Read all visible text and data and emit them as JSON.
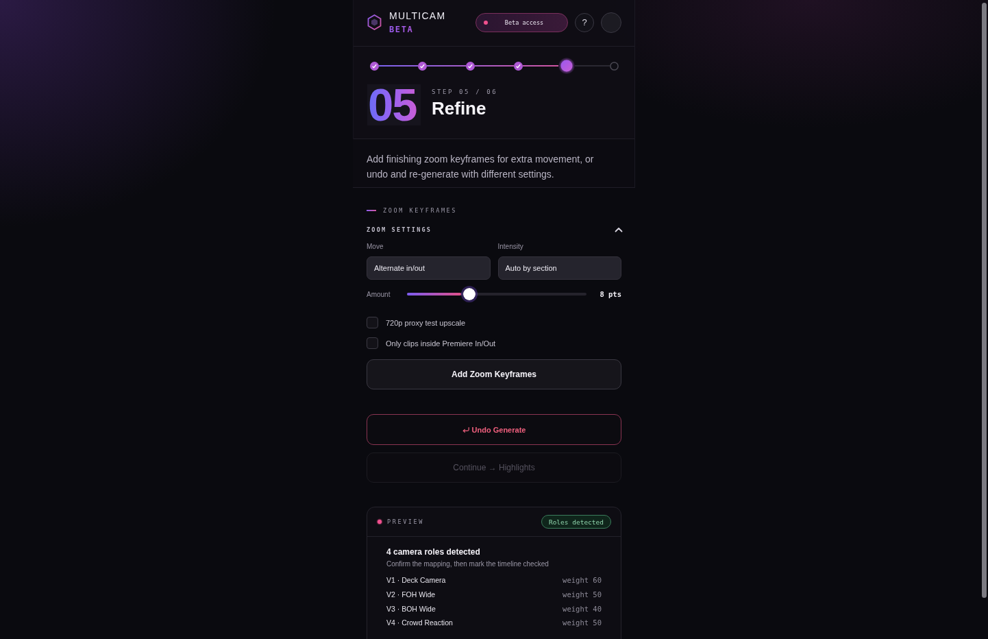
{
  "header": {
    "brand": "MULTICAM",
    "edition": "BETA",
    "access_button": {
      "label": "Beta access"
    },
    "help_button": {
      "label": "?"
    }
  },
  "stepper": {
    "steps": [
      {
        "completed": true,
        "selected": false
      },
      {
        "completed": true,
        "selected": false
      },
      {
        "completed": true,
        "selected": false
      },
      {
        "completed": true,
        "selected": false
      },
      {
        "completed": false,
        "selected": true
      },
      {
        "completed": false,
        "selected": false
      }
    ]
  },
  "step": {
    "number": "05",
    "counter": "STEP 05 / 06",
    "title": "Refine"
  },
  "description": "Add finishing zoom keyframes for extra movement, or undo and re-generate with different settings.",
  "section": {
    "label": "ZOOM KEYFRAMES"
  },
  "zoom_settings": {
    "title": "ZOOM SETTINGS",
    "expanded": true,
    "fields": [
      {
        "label": "Move",
        "value": "Alternate in/out"
      },
      {
        "label": "Intensity",
        "value": "Auto by section"
      }
    ],
    "amount": {
      "label": "Amount",
      "level": 0.345,
      "reading": "8 pts"
    },
    "options": [
      {
        "label": "720p proxy test upscale",
        "checked": false
      },
      {
        "label": "Only clips inside Premiere In/Out",
        "checked": false
      }
    ],
    "apply_button": {
      "label": "Add Zoom Keyframes"
    }
  },
  "actions": [
    {
      "kind": "undo",
      "label": "Undo Generate",
      "disabled": false
    },
    {
      "kind": "continue",
      "label": "Continue → Highlights",
      "disabled": true
    }
  ],
  "preview": {
    "label": "PREVIEW",
    "status": "Roles detected",
    "title": "4 camera roles detected",
    "subtitle": "Confirm the mapping, then mark the timeline checked",
    "roles": [
      {
        "name": "V1 · Deck Camera",
        "weight": "weight 60"
      },
      {
        "name": "V2 · FOH Wide",
        "weight": "weight 50"
      },
      {
        "name": "V3 · BOH Wide",
        "weight": "weight 40"
      },
      {
        "name": "V4 · Crowd Reaction",
        "weight": "weight 50"
      }
    ]
  }
}
